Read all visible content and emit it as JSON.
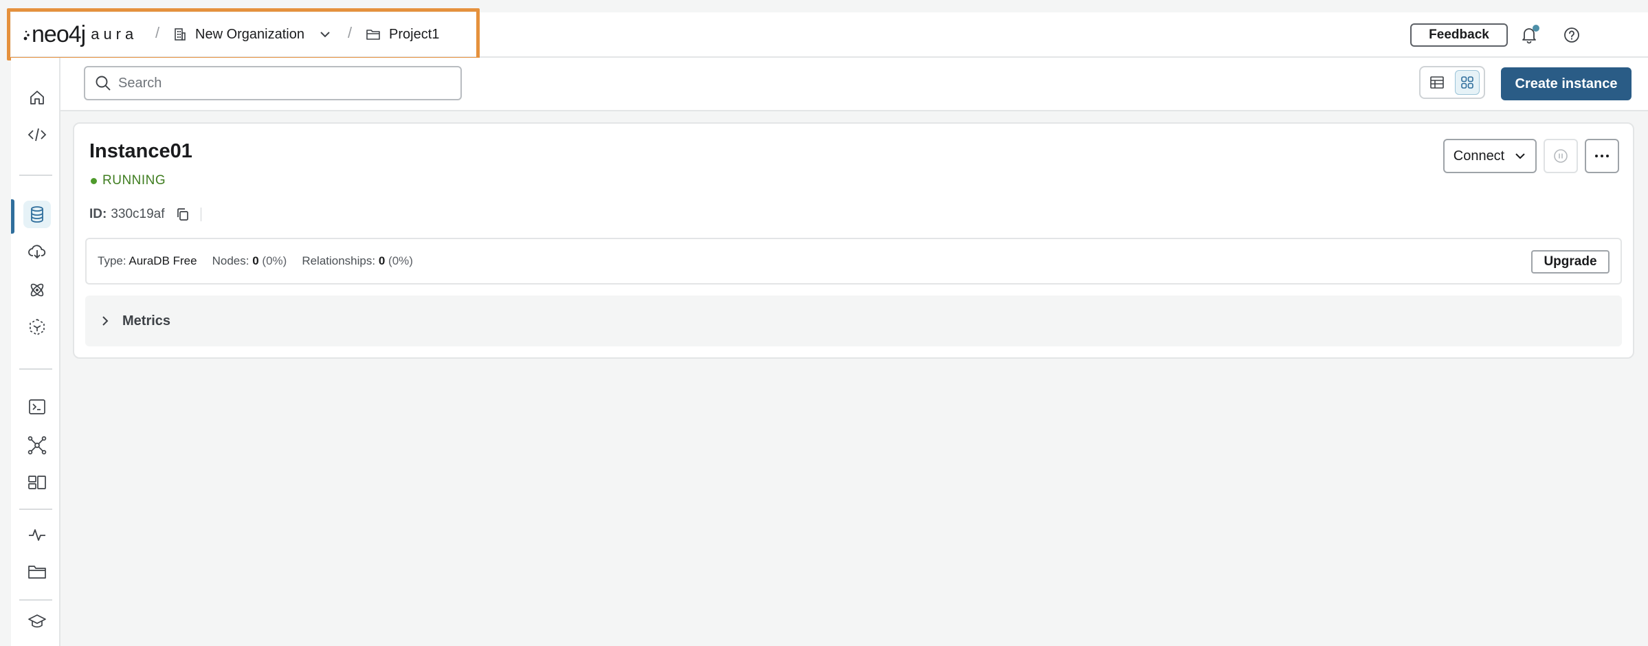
{
  "header": {
    "logo_text": "neo4j",
    "logo_sub": "aura",
    "breadcrumb": [
      {
        "label": "New Organization",
        "icon": "building-icon"
      },
      {
        "label": "Project1",
        "icon": "folder-icon"
      }
    ],
    "separator": "/",
    "feedback_label": "Feedback",
    "notification_dot_color": "#4d8fa8"
  },
  "sidebar": {
    "items": [
      {
        "name": "home",
        "icon": "home-icon"
      },
      {
        "name": "developer",
        "icon": "code-icon"
      },
      {
        "name": "instances",
        "icon": "database-icon",
        "active": true
      },
      {
        "name": "import",
        "icon": "cloud-download-icon"
      },
      {
        "name": "graph-analytics",
        "icon": "atom-icon"
      },
      {
        "name": "data-services",
        "icon": "cube-dashed-icon"
      },
      {
        "name": "query",
        "icon": "terminal-icon"
      },
      {
        "name": "explore",
        "icon": "graph-nodes-icon"
      },
      {
        "name": "dashboards",
        "icon": "dashboard-icon"
      },
      {
        "name": "metrics",
        "icon": "pulse-icon"
      },
      {
        "name": "projects",
        "icon": "folder-icon"
      },
      {
        "name": "learning",
        "icon": "graduation-cap-icon"
      }
    ],
    "accent_color": "#2f6e9c"
  },
  "toolbar": {
    "search_placeholder": "Search",
    "create_label": "Create instance",
    "create_color": "#2a5c86"
  },
  "instance": {
    "name": "Instance01",
    "status": "RUNNING",
    "status_color": "#3f7d20",
    "id_label": "ID:",
    "id_value": "330c19af",
    "connect_label": "Connect",
    "type_label": "Type:",
    "type_value": "AuraDB Free",
    "nodes_label": "Nodes:",
    "nodes_value": "0",
    "nodes_pct": "(0%)",
    "rels_label": "Relationships:",
    "rels_value": "0",
    "rels_pct": "(0%)",
    "upgrade_label": "Upgrade",
    "metrics_label": "Metrics"
  }
}
